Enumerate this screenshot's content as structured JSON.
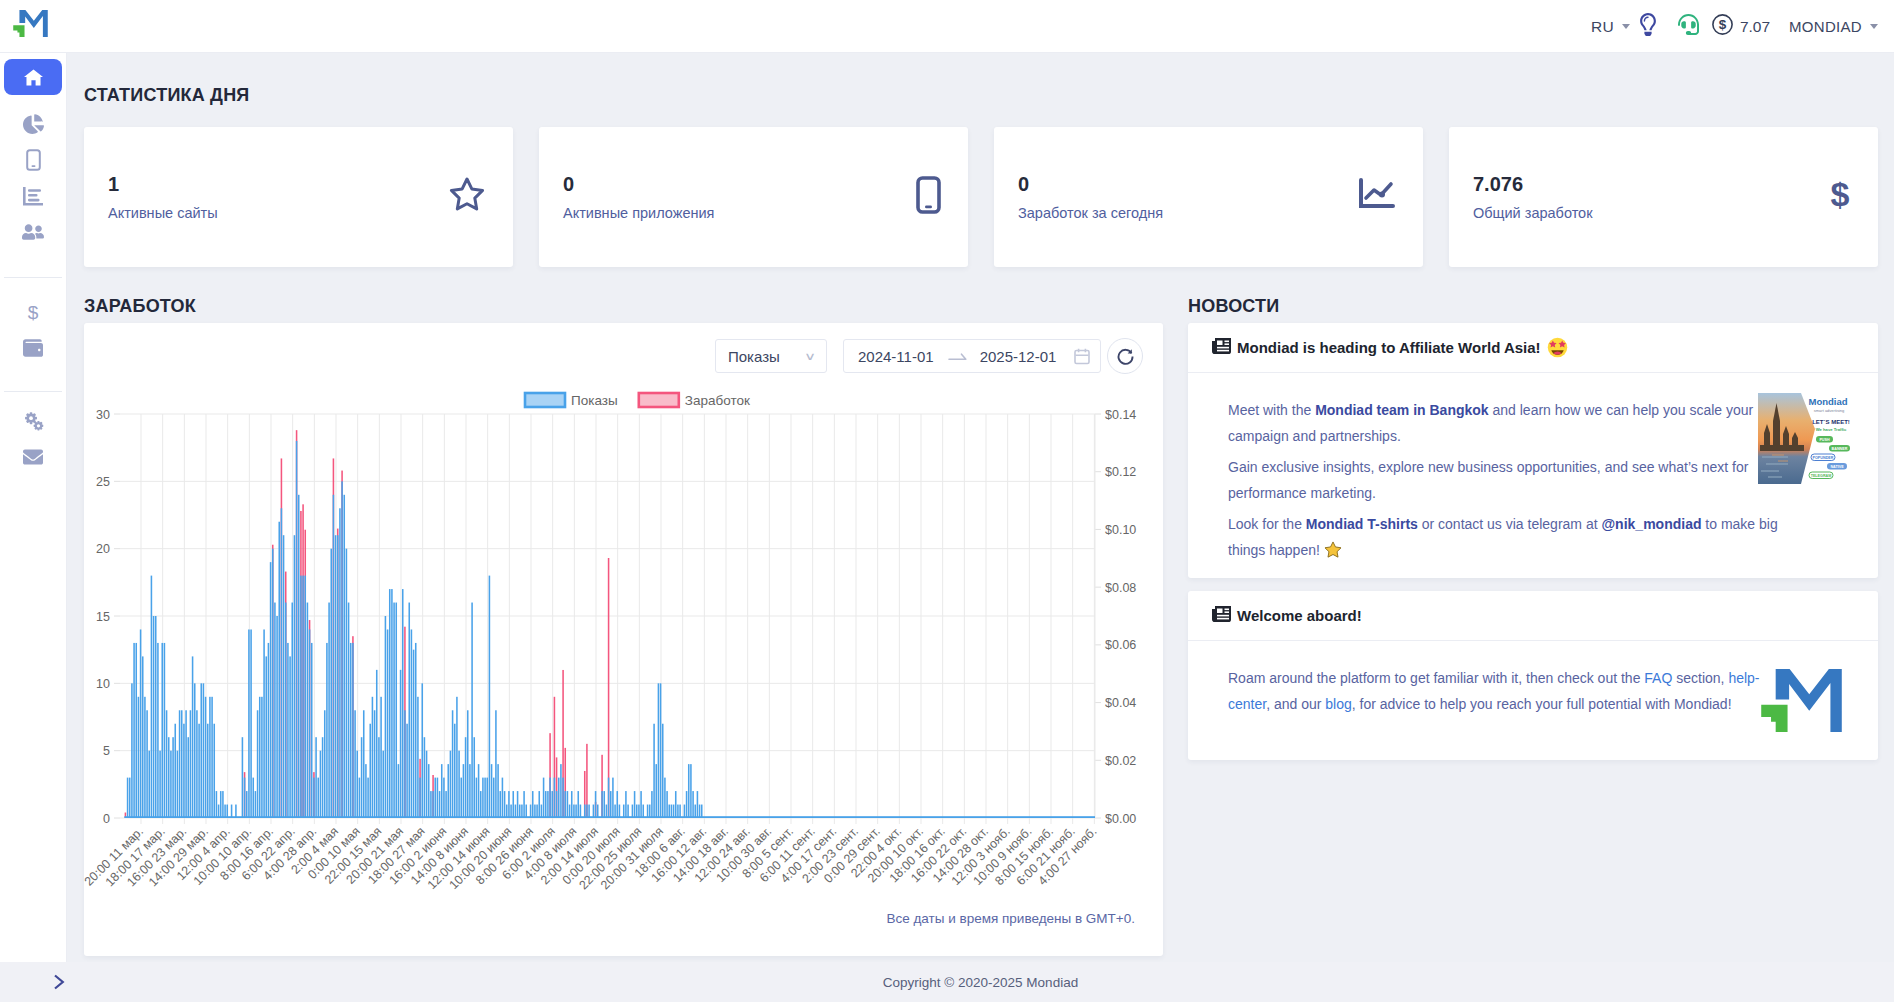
{
  "topbar": {
    "language": "RU",
    "balance": "7.07",
    "account": "MONDIAD"
  },
  "sidebar": {
    "items": [
      {
        "name": "dashboard",
        "icon": "home-icon",
        "active": true
      },
      {
        "name": "statistics",
        "icon": "pie-chart-icon",
        "active": false
      },
      {
        "name": "sites",
        "icon": "mobile-icon",
        "active": false
      },
      {
        "name": "reports",
        "icon": "bar-chart-icon",
        "active": false
      },
      {
        "name": "referrals",
        "icon": "users-icon",
        "active": false
      },
      {
        "name": "payments",
        "icon": "dollar-icon",
        "active": false
      },
      {
        "name": "wallet",
        "icon": "wallet-icon",
        "active": false
      },
      {
        "name": "settings",
        "icon": "gears-icon",
        "active": false
      },
      {
        "name": "messages",
        "icon": "envelope-icon",
        "active": false
      }
    ]
  },
  "stats_section": {
    "title": "СТАТИСТИКА ДНЯ",
    "cards": [
      {
        "value": "1",
        "label": "Активные сайты",
        "icon": "star-icon"
      },
      {
        "value": "0",
        "label": "Активные приложения",
        "icon": "mobile-icon"
      },
      {
        "value": "0",
        "label": "Заработок за сегодня",
        "icon": "chart-line-icon"
      },
      {
        "value": "7.076",
        "label": "Общий заработок",
        "icon": "dollar-icon"
      }
    ]
  },
  "earnings_section": {
    "title": "ЗАРАБОТОК",
    "metric_select": {
      "value": "Показы"
    },
    "date_from": "2024-11-01",
    "date_to": "2025-12-01",
    "gmt_note": "Все даты и время приведены в GMT+0."
  },
  "chart_data": {
    "type": "bar",
    "title": "",
    "xlabel": "",
    "ylabel_left": "Показы",
    "ylabel_right": "Заработок",
    "legend": [
      {
        "label": "Показы",
        "fill": "#a9d3f5",
        "border": "#49a2e9"
      },
      {
        "label": "Заработок",
        "fill": "#f9bcca",
        "border": "#f4567e"
      }
    ],
    "ylim_left": [
      0,
      30
    ],
    "ylim_right": [
      0,
      0.14
    ],
    "yticks_left": [
      0,
      5,
      10,
      15,
      20,
      25,
      30
    ],
    "yticks_right": [
      "$0.00",
      "$0.02",
      "$0.04",
      "$0.06",
      "$0.08",
      "$0.10",
      "$0.12",
      "$0.14"
    ],
    "xticklabels": [
      "20:00 11 мар.",
      "18:00 17 мар.",
      "16:00 23 мар.",
      "14:00 29 мар.",
      "12:00 4 апр.",
      "10:00 10 апр.",
      "8:00 16 апр.",
      "6:00 22 апр.",
      "4:00 28 апр.",
      "2:00 4 мая",
      "0:00 10 мая",
      "22:00 15 мая",
      "20:00 21 мая",
      "18:00 27 мая",
      "16:00 2 июня",
      "14:00 8 июня",
      "12:00 14 июня",
      "10:00 20 июня",
      "8:00 26 июня",
      "6:00 2 июля",
      "4:00 8 июля",
      "2:00 14 июля",
      "0:00 20 июля",
      "22:00 25 июля",
      "20:00 31 июля",
      "18:00 6 авг.",
      "16:00 12 авг.",
      "14:00 18 авг.",
      "12:00 24 авг.",
      "10:00 30 авг.",
      "8:00 5 сент.",
      "6:00 11 сент.",
      "4:00 17 сент.",
      "2:00 23 сент.",
      "0:00 29 сент.",
      "22:00 4 окт.",
      "20:00 10 окт.",
      "18:00 16 окт.",
      "16:00 22 окт.",
      "14:00 28 окт.",
      "12:00 3 нояб.",
      "10:00 9 нояб.",
      "8:00 15 нояб.",
      "6:00 21 нояб.",
      "4:00 27 нояб."
    ],
    "series": [
      {
        "name": "Показы",
        "axis": "left",
        "color": "#49a2e9",
        "values": [
          0.0,
          0.0,
          0.0,
          3,
          3,
          10,
          13,
          13,
          9,
          14,
          12,
          9,
          8,
          5,
          18,
          15,
          15,
          13,
          5,
          13,
          13,
          8,
          6,
          5,
          6,
          7,
          5,
          8,
          8,
          7,
          8,
          6,
          8,
          12,
          10,
          8,
          7,
          10,
          10,
          9,
          7,
          9,
          9,
          7,
          2,
          1,
          2,
          2,
          1,
          1,
          0,
          1,
          0,
          1,
          0,
          0,
          6,
          3,
          2,
          14,
          14,
          3,
          2,
          8,
          9,
          9,
          14,
          12,
          13,
          19,
          20,
          16,
          15,
          22,
          23,
          21,
          16,
          13,
          12,
          16,
          21,
          28,
          24,
          18,
          18,
          18,
          16,
          14,
          13,
          3,
          6,
          3,
          5,
          6,
          8,
          13,
          16,
          20,
          24,
          21,
          21,
          23,
          25,
          24,
          20,
          16,
          13,
          13,
          8,
          5,
          3,
          6,
          8,
          4,
          3,
          7,
          9,
          8,
          11,
          6,
          9,
          5,
          15,
          14,
          17,
          17,
          16,
          16,
          4,
          11,
          17,
          8,
          7,
          16,
          14,
          12.5,
          13,
          9,
          3,
          10,
          6,
          5,
          4,
          2,
          2,
          3,
          3,
          2,
          4,
          3,
          2,
          4,
          5,
          8,
          7,
          9,
          5,
          3,
          4,
          6,
          8,
          4,
          16,
          6,
          3,
          4,
          2,
          3,
          3,
          3,
          18,
          4,
          3,
          8,
          4,
          2,
          3,
          2,
          1,
          2,
          1,
          2,
          1,
          2,
          1,
          1,
          2,
          1,
          0,
          1,
          2,
          1,
          1,
          2,
          1,
          3,
          2,
          2,
          3,
          2,
          3,
          2,
          3,
          4,
          3,
          2,
          2,
          1,
          2,
          1,
          1,
          2,
          1,
          0,
          1,
          1,
          1,
          0,
          1,
          2,
          1,
          0,
          2,
          2,
          1,
          3,
          2,
          3,
          1,
          2,
          1,
          0,
          1,
          2,
          1,
          0,
          1,
          2,
          1,
          1,
          2,
          1,
          0,
          1,
          1,
          2,
          7,
          4,
          10,
          10,
          7,
          3,
          2,
          1,
          1,
          1,
          2,
          1,
          1,
          0,
          1,
          2,
          4,
          4,
          2,
          1,
          2,
          1,
          1,
          0.0,
          0.0,
          0.0,
          0.0,
          0.0,
          0.0,
          0.0,
          0.0,
          0.0,
          0.0,
          0.0,
          0.0,
          0.0,
          0.0,
          0.0,
          0.0,
          0.0,
          0.0,
          0.0,
          0.0,
          0.0,
          0.0,
          0.0,
          0.0,
          0.0,
          0.0,
          0.0,
          0.0,
          0.0,
          0.0,
          0.0,
          0.0,
          0.0,
          0.0,
          0.0,
          0.0,
          0.0,
          0.0,
          0.0,
          0.0,
          0.0,
          0.0,
          0.0,
          0.0,
          0.0,
          0.0,
          0.0,
          0.0,
          0.0,
          0.0,
          0.0,
          0.0,
          0.0,
          0.0,
          0.0,
          0.0,
          0.0,
          0.0,
          0.0,
          0.0,
          0.0,
          0.0,
          0.0,
          0.0,
          0.0,
          0.0,
          0.0,
          0.0,
          0.0,
          0.0,
          0.0,
          0.0,
          0.0,
          0.0,
          0.0,
          0.0,
          0.0,
          0.0,
          0.0,
          0.0,
          0.0,
          0.0,
          0.0,
          0.0,
          0.0,
          0.0,
          0.0,
          0.0,
          0.0,
          0.0,
          0.0,
          0.0,
          0.0,
          0.0,
          0.0,
          0.0,
          0.0,
          0.0,
          0.0,
          0.0,
          0.0,
          0.0,
          0.0,
          0.0,
          0.0,
          0.0,
          0.0,
          0.0,
          0.0,
          0.0,
          0.0,
          0.0,
          0.0,
          0.0,
          0.0,
          0.0,
          0.0,
          0.0,
          0.0,
          0.0,
          0.0,
          0.0,
          0.0,
          0.0,
          0.0,
          0.0,
          0.0,
          0.0,
          0.0,
          0.0,
          0.0,
          0.0,
          0.0,
          0.0,
          0.0,
          0.0,
          0.0,
          0.0,
          0.0,
          0.0,
          0.0,
          0.0,
          0.0,
          0.0,
          0.0,
          0.0,
          0.0,
          0.0,
          0.0,
          0.0,
          0.0,
          0.0,
          0.0,
          0.0,
          0.0,
          0.0,
          0.0,
          0.0,
          0.0,
          0.0,
          0.0,
          0.0,
          0.0,
          0.0,
          0.0,
          0.0,
          0.0,
          0.0,
          0.0,
          0.0,
          0.0,
          0.0,
          0.0,
          0.0,
          0.0,
          0.0,
          0.0,
          0.0,
          0.0,
          0.0,
          0.0
        ]
      },
      {
        "name": "Заработок",
        "axis": "right",
        "color": "#f4567e",
        "values": [
          0.0,
          0.0,
          0.0019,
          0.0,
          0.0,
          0.0,
          0.0,
          0.0,
          0.0,
          0.0,
          0.0,
          0.0,
          0.0,
          0.0,
          0.0,
          0.0,
          0.0,
          0.0,
          0.0,
          0.0,
          0.0,
          0.0,
          0.0,
          0.0,
          0.0,
          0.0,
          0.0,
          0.0,
          0.0,
          0.0,
          0.0,
          0.0,
          0.0,
          0.0,
          0.0,
          0.0,
          0.0,
          0.0,
          0.0,
          0.0,
          0.0,
          0.0,
          0.0,
          0.0,
          0.0,
          0.0,
          0.0,
          0.0,
          0.0,
          0.0,
          0.0,
          0.0,
          0.0,
          0.0,
          0.0,
          0.0,
          0.0,
          0.0159,
          0.0,
          0.0,
          0.0,
          0.0,
          0.0,
          0.0,
          0.0,
          0.0,
          0.0,
          0.0,
          0.0,
          0.0,
          0.0947,
          0.0,
          0.0,
          0.0,
          0.1246,
          0.0,
          0.0854,
          0.0,
          0.0,
          0.0,
          0.0,
          0.1344,
          0.0,
          0.1064,
          0.1087,
          0.0999,
          0.0,
          0.0686,
          0.0,
          0.0159,
          0.0,
          0.0,
          0.0,
          0.0,
          0.0,
          0.0,
          0.0,
          0.0,
          0.1246,
          0.0,
          0.1003,
          0.0,
          0.1204,
          0.0,
          0.0,
          0.0,
          0.0,
          0.063,
          0.0,
          0.0,
          0.0,
          0.0,
          0.0,
          0.0,
          0.0,
          0.0,
          0.0,
          0.0,
          0.0,
          0.0,
          0.0,
          0.0,
          0.0,
          0.0,
          0.0,
          0.0,
          0.0,
          0.0,
          0.0,
          0.0,
          0.0,
          0.0663,
          0.0,
          0.0,
          0.0,
          0.0,
          0.0,
          0.0,
          0.0205,
          0.0,
          0.0,
          0.0,
          0.0,
          0.0,
          0.0149,
          0.0,
          0.0,
          0.0,
          0.0,
          0.0,
          0.0,
          0.0,
          0.0,
          0.0,
          0.0,
          0.0,
          0.0,
          0.0,
          0.0,
          0.0,
          0.0,
          0.0,
          0.0,
          0.0,
          0.0,
          0.0,
          0.0,
          0.0,
          0.0,
          0.0,
          0.0,
          0.0,
          0.0,
          0.0,
          0.0,
          0.0,
          0.0,
          0.0,
          0.0,
          0.0,
          0.0,
          0.0,
          0.0,
          0.0,
          0.0,
          0.0,
          0.0,
          0.0,
          0.0,
          0.0,
          0.0,
          0.0,
          0.0,
          0.0,
          0.0,
          0.0,
          0.0,
          0.0,
          0.0294,
          0.0,
          0.042,
          0.021,
          0.0,
          0.0,
          0.0513,
          0.0243,
          0.0,
          0.0,
          0.0,
          0.0,
          0.0,
          0.0,
          0.0,
          0.0,
          0.0163,
          0.0257,
          0.0,
          0.0,
          0.0,
          0.0056,
          0.0,
          0.0,
          0.0219,
          0.0,
          0.0,
          0.0901,
          0.0,
          0.0,
          0.0,
          0.0,
          0.0,
          0.0,
          0.0,
          0.0,
          0.0,
          0.0,
          0.0,
          0.0,
          0.0,
          0.0,
          0.0,
          0.0,
          0.0,
          0.0,
          0.0,
          0.0,
          0.0,
          0.0,
          0.0,
          0.0,
          0.0,
          0.0,
          0.0,
          0.0,
          0.0,
          0.0,
          0.0,
          0.0,
          0.0,
          0.0,
          0.0,
          0.0,
          0.0,
          0.0,
          0.0,
          0.0,
          0.0,
          0.0,
          0.0,
          0.0,
          0.0,
          0.0,
          0.0,
          0.0,
          0.0,
          0.0,
          0.0,
          0.0,
          0.0,
          0.0,
          0.0,
          0.0,
          0.0,
          0.0,
          0.0,
          0.0,
          0.0,
          0.0,
          0.0,
          0.0,
          0.0,
          0.0,
          0.0,
          0.0,
          0.0,
          0.0,
          0.0,
          0.0,
          0.0,
          0.0,
          0.0,
          0.0,
          0.0,
          0.0,
          0.0,
          0.0,
          0.0,
          0.0,
          0.0,
          0.0,
          0.0,
          0.0,
          0.0,
          0.0,
          0.0,
          0.0,
          0.0,
          0.0,
          0.0,
          0.0,
          0.0,
          0.0,
          0.0,
          0.0,
          0.0,
          0.0,
          0.0,
          0.0,
          0.0,
          0.0,
          0.0,
          0.0,
          0.0,
          0.0,
          0.0,
          0.0,
          0.0,
          0.0,
          0.0,
          0.0,
          0.0,
          0.0,
          0.0,
          0.0,
          0.0,
          0.0,
          0.0,
          0.0,
          0.0,
          0.0,
          0.0,
          0.0,
          0.0,
          0.0,
          0.0,
          0.0,
          0.0,
          0.0,
          0.0,
          0.0,
          0.0,
          0.0,
          0.0,
          0.0,
          0.0,
          0.0,
          0.0,
          0.0,
          0.0,
          0.0,
          0.0,
          0.0,
          0.0,
          0.0,
          0.0,
          0.0,
          0.0,
          0.0,
          0.0,
          0.0,
          0.0,
          0.0,
          0.0,
          0.0,
          0.0,
          0.0,
          0.0,
          0.0,
          0.0,
          0.0,
          0.0,
          0.0,
          0.0,
          0.0,
          0.0,
          0.0,
          0.0,
          0.0,
          0.0,
          0.0,
          0.0,
          0.0,
          0.0,
          0.0,
          0.0,
          0.0,
          0.0,
          0.0,
          0.0,
          0.0,
          0.0,
          0.0,
          0.0,
          0.0,
          0.0,
          0.0,
          0.0,
          0.0,
          0.0,
          0.0,
          0.0,
          0.0,
          0.0,
          0.0,
          0.0,
          0.0,
          0.0,
          0.0,
          0.0,
          0.0,
          0.0,
          0.0,
          0.0,
          0.0,
          0.0,
          0.0,
          0.0,
          0.0,
          0.0,
          0.0,
          0.0,
          0.0,
          0.0,
          0.0,
          0.0,
          0.0,
          0.0,
          0.0,
          0.0,
          0.0
        ]
      }
    ],
    "grid": true,
    "legend_position": "top"
  },
  "news_section": {
    "title": "НОВОСТИ",
    "items": [
      {
        "title": "Mondiad is heading to Affiliate World Asia!",
        "title_emoji": "star-struck-emoji",
        "paragraphs": [
          [
            {
              "t": "Meet with the ",
              "s": "n"
            },
            {
              "t": "Mondiad team in Bangkok",
              "s": "b"
            },
            {
              "t": " and learn how we can help you scale your campaign and partnerships.",
              "s": "n"
            }
          ],
          [
            {
              "t": "Gain exclusive insights, explore new business opportunities, and see what’s next for performance marketing.",
              "s": "n"
            }
          ],
          [
            {
              "t": "Look for the ",
              "s": "n"
            },
            {
              "t": "Mondiad T-shirts",
              "s": "b"
            },
            {
              "t": " or contact us via telegram at ",
              "s": "n"
            },
            {
              "t": "@nik_mondiad",
              "s": "b"
            },
            {
              "t": " to make big things happen! ",
              "s": "n"
            },
            {
              "t": "⭐",
              "s": "star"
            }
          ]
        ],
        "image": {
          "name": "affiliate-world-asia-banner",
          "brand": "Mondiad",
          "brand_sub": "smart advertising",
          "headline": "LET`S MEET!",
          "subline": "We have Traffic",
          "badges": [
            "PUSH",
            "BANNER",
            "POPUNDER",
            "NATIVE",
            "TELEGRAM"
          ]
        }
      },
      {
        "title": "Welcome aboard!",
        "paragraphs": [
          [
            {
              "t": "Roam around the platform to get familiar with it, then check out the ",
              "s": "n"
            },
            {
              "t": "FAQ",
              "s": "l"
            },
            {
              "t": " section, ",
              "s": "n"
            },
            {
              "t": "help-center",
              "s": "l"
            },
            {
              "t": ", and our ",
              "s": "n"
            },
            {
              "t": "blog",
              "s": "l"
            },
            {
              "t": ", for advice to help you reach your full potential with Mondiad!",
              "s": "n"
            }
          ]
        ],
        "image": {
          "name": "mondiad-logo"
        }
      }
    ]
  },
  "footer": {
    "copyright": "Copyright © 2020-2025 Mondiad"
  },
  "colors": {
    "accent_blue": "#4a6cf3",
    "bar_blue": "#49a2e9",
    "bar_pink": "#f4567e",
    "logo_blue": "#3678c1",
    "logo_green": "#4cb944",
    "headset_green": "#2fb37e"
  }
}
